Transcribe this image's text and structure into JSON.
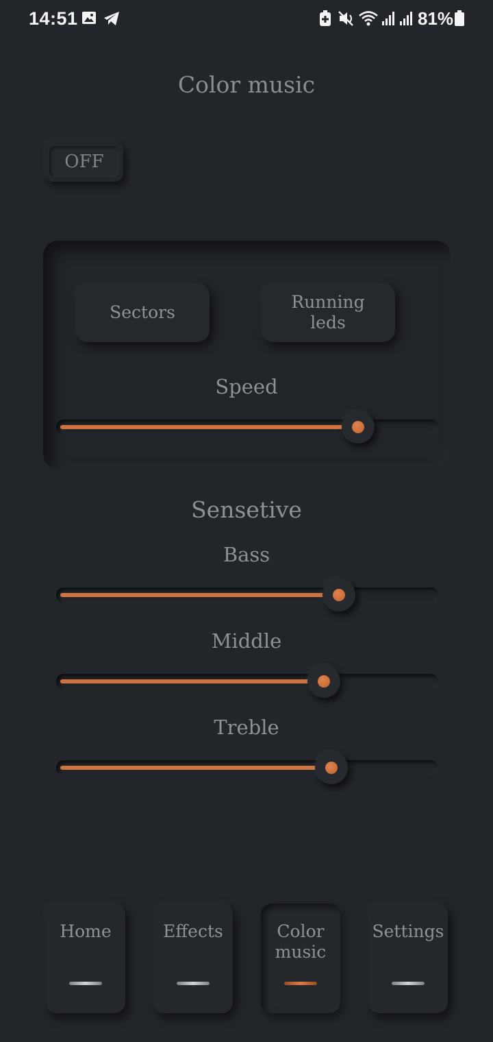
{
  "status_bar": {
    "time": "14:51",
    "battery_percent": "81%",
    "icons": [
      "gallery-icon",
      "telegram-icon",
      "battery-saver-icon",
      "mute-icon",
      "wifi-icon",
      "signal-icon",
      "signal-icon",
      "battery-icon"
    ]
  },
  "header": {
    "title": "Color music"
  },
  "power_toggle": {
    "label": "OFF"
  },
  "mode_panel": {
    "modes": [
      {
        "label": "Sectors"
      },
      {
        "label": "Running leds"
      }
    ],
    "speed": {
      "label": "Speed",
      "value_fraction": 0.79
    }
  },
  "sensitivity": {
    "heading": "Sensetive",
    "bass": {
      "label": "Bass",
      "value_fraction": 0.74
    },
    "middle": {
      "label": "Middle",
      "value_fraction": 0.7
    },
    "treble": {
      "label": "Treble",
      "value_fraction": 0.72
    }
  },
  "bottom_nav": {
    "items": [
      {
        "label": "Home",
        "active": false
      },
      {
        "label": "Effects",
        "active": false
      },
      {
        "label": "Color music",
        "active": true
      },
      {
        "label": "Settings",
        "active": false
      }
    ]
  },
  "colors": {
    "background": "#222529",
    "accent": "#cf7440",
    "text": "#8f9397"
  }
}
